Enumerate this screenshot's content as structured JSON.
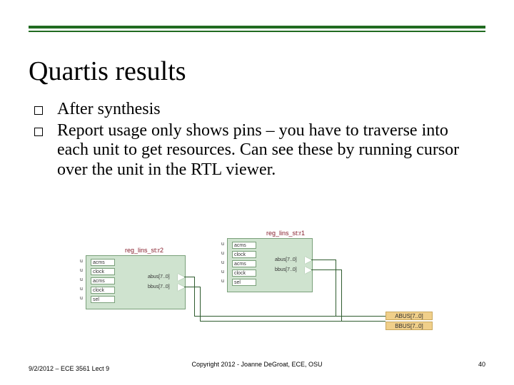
{
  "title": "Quartis results",
  "bullets": [
    "After synthesis",
    "Report usage only shows pins – you have to traverse into each unit to get resources.  Can see these by running cursor over the unit in the RTL viewer."
  ],
  "diagram": {
    "blockA_label": "reg_lins_st:r2",
    "blockB_label": "reg_lins_st:r1",
    "portsA_left": [
      "acms",
      "clock",
      "acms",
      "clock",
      "sel"
    ],
    "portsA_right": [
      "abus[7..0]",
      "bbus[7..0]"
    ],
    "portsB_left": [
      "acms",
      "clock",
      "acms",
      "clock",
      "sel"
    ],
    "portsB_right": [
      "abus[7..0]",
      "bbus[7..0]"
    ],
    "bus_labels": [
      "ABUS[7..0]",
      "BBUS[7..0]"
    ]
  },
  "footer": {
    "left": "9/2/2012 – ECE 3561 Lect 9",
    "center": "Copyright 2012 - Joanne DeGroat, ECE, OSU",
    "right": "40"
  }
}
